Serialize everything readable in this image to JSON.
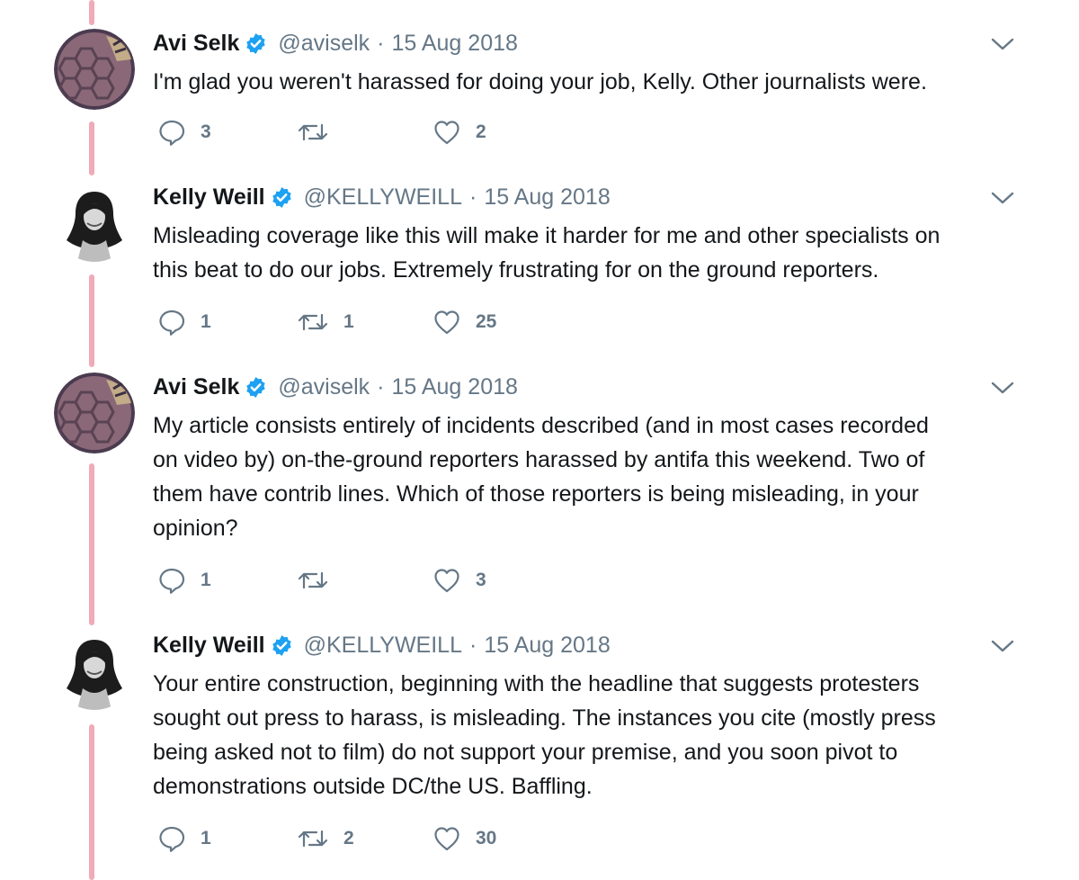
{
  "tweets": [
    {
      "author": "Avi Selk",
      "handle": "@aviselk",
      "separator": "·",
      "date": "15 Aug 2018",
      "lines": [
        "I'm glad you weren't harassed for doing your job, Kelly. Other journalists were."
      ],
      "replies": "3",
      "retweets": "",
      "likes": "2"
    },
    {
      "author": "Kelly Weill",
      "handle": "@KELLYWEILL",
      "separator": "·",
      "date": "15 Aug 2018",
      "lines": [
        "Misleading coverage like this will make it harder for me and other specialists on",
        "this beat to do our jobs. Extremely frustrating for on the ground reporters."
      ],
      "replies": "1",
      "retweets": "1",
      "likes": "25"
    },
    {
      "author": "Avi Selk",
      "handle": "@aviselk",
      "separator": "·",
      "date": "15 Aug 2018",
      "lines": [
        "My article consists entirely of incidents described (and in most cases recorded",
        "on video by) on-the-ground reporters harassed by antifa this weekend. Two of",
        "them have contrib lines. Which of those reporters is being misleading, in your",
        "opinion?"
      ],
      "replies": "1",
      "retweets": "",
      "likes": "3"
    },
    {
      "author": "Kelly Weill",
      "handle": "@KELLYWEILL",
      "separator": "·",
      "date": "15 Aug 2018",
      "lines": [
        "Your entire construction, beginning with the headline that suggests protesters",
        "sought out press to harass, is misleading. The instances you cite (mostly press",
        "being asked not to film) do not support your premise, and you soon pivot to",
        "demonstrations outside DC/the US. Baffling."
      ],
      "replies": "1",
      "retweets": "2",
      "likes": "30"
    }
  ],
  "icons": {
    "reply": "reply-icon",
    "retweet": "retweet-icon",
    "like": "heart-icon",
    "verified": "verified-badge-icon",
    "more": "chevron-down-icon"
  },
  "colors": {
    "thread_line": "#f0aab8",
    "verified": "#1da1f2",
    "secondary_text": "#657786",
    "primary_text": "#14171a"
  }
}
